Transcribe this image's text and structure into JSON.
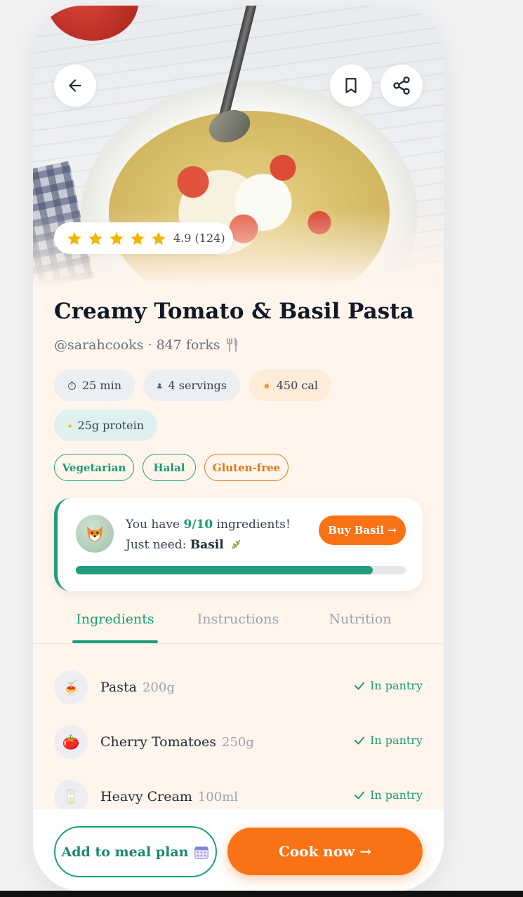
{
  "hero": {
    "rating_value": "4.9 (124)",
    "stars": 5,
    "back_icon": "arrow-left-icon",
    "bookmark_icon": "bookmark-icon",
    "share_icon": "share-icon"
  },
  "recipe": {
    "title": "Creamy Tomato & Basil Pasta",
    "author": "@sarahcooks",
    "separator": "·",
    "forks": "847 forks",
    "stats": {
      "time": "25 min",
      "servings": "4 servings",
      "calories": "450 cal",
      "protein": "25g protein"
    },
    "tags": [
      "Vegetarian",
      "Halal",
      "Gluten-free"
    ]
  },
  "pantry": {
    "prefix": "You have ",
    "count": "9/10",
    "middle": " ingredients! Just need: ",
    "missing": "Basil",
    "buy_label": "Buy Basil →",
    "progress": 0.9
  },
  "tabs": [
    "Ingredients",
    "Instructions",
    "Nutrition"
  ],
  "active_tab": "Ingredients",
  "ingredients": [
    {
      "name": "Pasta",
      "qty": "200g",
      "status": "In pantry",
      "icon": "🍝"
    },
    {
      "name": "Cherry Tomatoes",
      "qty": "250g",
      "status": "In pantry",
      "icon": "🍅"
    },
    {
      "name": "Heavy Cream",
      "qty": "100ml",
      "status": "In pantry",
      "icon": "🥛"
    }
  ],
  "actions": {
    "meal_plan": "Add to meal plan",
    "cook_now": "Cook now →"
  },
  "colors": {
    "accent_green": "#1f9d7c",
    "accent_orange": "#f97316",
    "background": "#fff5ec"
  }
}
